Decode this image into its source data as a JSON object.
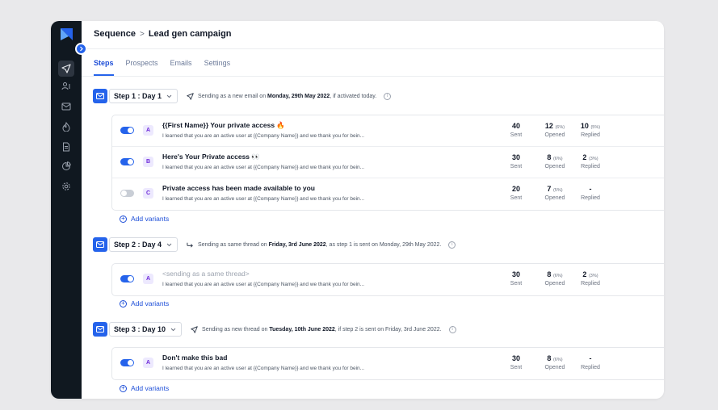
{
  "breadcrumb": {
    "root": "Sequence",
    "separator": ">",
    "current": "Lead gen campaign"
  },
  "tabs": [
    {
      "label": "Steps",
      "active": true
    },
    {
      "label": "Prospects",
      "active": false
    },
    {
      "label": "Emails",
      "active": false
    },
    {
      "label": "Settings",
      "active": false
    }
  ],
  "sidebar": {
    "icons": [
      "send-icon",
      "users-icon",
      "mail-check-icon",
      "flame-icon",
      "document-icon",
      "pie-chart-icon",
      "gear-icon"
    ]
  },
  "steps": [
    {
      "label": "Step 1 : Day 1",
      "desc_prefix": "Sending as a new email on ",
      "desc_bold": "Monday, 29th May 2022",
      "desc_suffix": ", if activated today.",
      "send_icon": "paper-plane-icon",
      "variants": [
        {
          "on": true,
          "badge": "A",
          "subject": "{{First Name}} Your private access 🔥",
          "preview": "I learned that you are an active user at {{Company Name}} and we thank you for bein...",
          "sent": "40",
          "opened": "12",
          "opened_pct": "(6%)",
          "replied": "10",
          "replied_pct": "(5%)"
        },
        {
          "on": true,
          "badge": "B",
          "subject": "Here's Your Private access 👀",
          "preview": "I learned that you are an active user at {{Company Name}} and we thank you for bein...",
          "sent": "30",
          "opened": "8",
          "opened_pct": "(6%)",
          "replied": "2",
          "replied_pct": "(3%)"
        },
        {
          "on": false,
          "badge": "C",
          "subject": "Private access has been made available to you",
          "preview": "I learned that you are an active user at {{Company Name}} and we thank you for bein...",
          "sent": "20",
          "opened": "7",
          "opened_pct": "(5%)",
          "replied": "-",
          "replied_pct": ""
        }
      ]
    },
    {
      "label": "Step 2 : Day 4",
      "desc_prefix": "Sending as same thread on ",
      "desc_bold": "Friday, 3rd June 2022",
      "desc_suffix": ", as step 1 is sent on Monday, 29th May 2022.",
      "send_icon": "reply-arrow-icon",
      "variants": [
        {
          "on": true,
          "badge": "A",
          "subject": "<sending as a same thread>",
          "muted": true,
          "preview": "I learned that you are an active user at {{Company Name}} and we thank you for bein...",
          "sent": "30",
          "opened": "8",
          "opened_pct": "(6%)",
          "replied": "2",
          "replied_pct": "(3%)"
        }
      ]
    },
    {
      "label": "Step 3 : Day 10",
      "desc_prefix": "Sending as new thread on ",
      "desc_bold": "Tuesday, 10th June 2022",
      "desc_suffix": ", if step 2 is sent on Friday, 3rd June 2022.",
      "send_icon": "paper-plane-icon",
      "variants": [
        {
          "on": true,
          "badge": "A",
          "subject": "Don't make this bad",
          "preview": "I learned that you are an active user at {{Company Name}} and we thank you for bein...",
          "sent": "30",
          "opened": "8",
          "opened_pct": "(6%)",
          "replied": "-",
          "replied_pct": ""
        }
      ]
    }
  ],
  "stat_labels": {
    "sent": "Sent",
    "opened": "Opened",
    "replied": "Replied"
  },
  "add_variants_label": "Add variants",
  "colors": {
    "accent": "#2563eb",
    "sidebar": "#101820",
    "badge_bg": "#ede9fe",
    "badge_fg": "#6d28d9"
  }
}
